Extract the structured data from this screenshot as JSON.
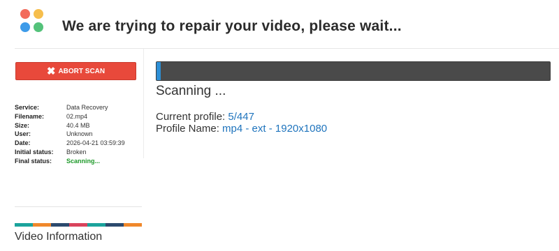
{
  "header": {
    "title": "We are trying to repair your video, please wait...",
    "logo_colors": [
      "#f26b5b",
      "#f6be4c",
      "#3d9be9",
      "#54c27a"
    ]
  },
  "sidebar": {
    "abort_label": "ABORT SCAN",
    "info": [
      {
        "key": "Service:",
        "value": "Data Recovery"
      },
      {
        "key": "Filename:",
        "value": "02.mp4"
      },
      {
        "key": "Size:",
        "value": "40.4 MB"
      },
      {
        "key": "User:",
        "value": "Unknown"
      },
      {
        "key": "Date:",
        "value": "2026-04-21 03:59:39"
      },
      {
        "key": "Initial status:",
        "value": "Broken"
      },
      {
        "key": "Final status:",
        "value": "Scanning..."
      }
    ],
    "color_strip": [
      "#1ba39c",
      "#f0882b",
      "#2c4a6e",
      "#d9435c",
      "#1ba39c",
      "#2c4a6e",
      "#f0882b"
    ],
    "video_info_label": "Video Information"
  },
  "main": {
    "progress_fraction": 0.01,
    "status_text": "Scanning ...",
    "current_profile_label": "Current profile: ",
    "current_profile_value": "5/447",
    "profile_name_label": "Profile Name: ",
    "profile_name_value": "mp4 - ext - 1920x1080"
  },
  "colors": {
    "accent_blue": "#1f74bd",
    "abort_red": "#e8493b",
    "progress_track": "#4a4a4a",
    "progress_fill": "#2d8fd6",
    "success_green": "#1e9a2a"
  }
}
